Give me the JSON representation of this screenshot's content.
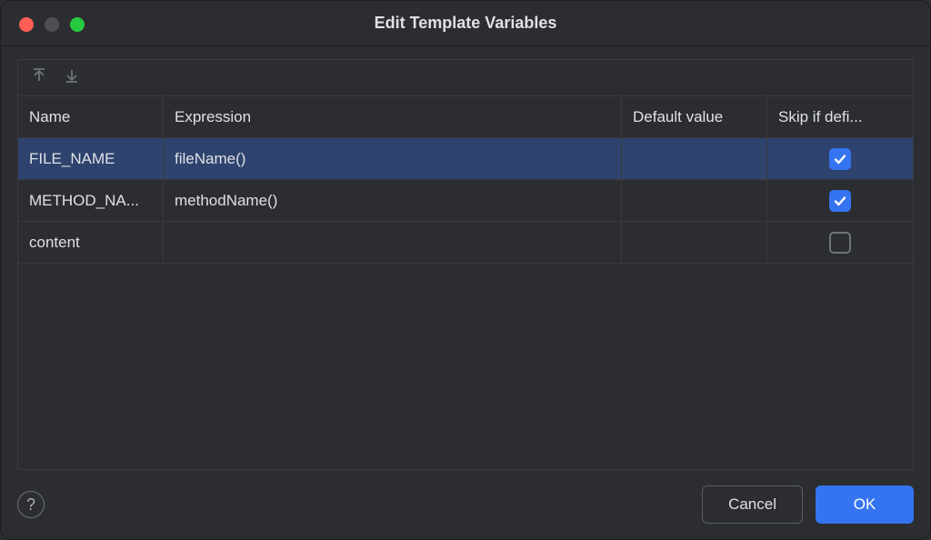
{
  "window": {
    "title": "Edit Template Variables"
  },
  "table": {
    "headers": {
      "name": "Name",
      "expression": "Expression",
      "default_value": "Default value",
      "skip": "Skip if defi..."
    },
    "rows": [
      {
        "name": "FILE_NAME",
        "expression": "fileName()",
        "default_value": "",
        "skip": true,
        "selected": true
      },
      {
        "name": "METHOD_NA...",
        "expression": "methodName()",
        "default_value": "",
        "skip": true,
        "selected": false
      },
      {
        "name": "content",
        "expression": "",
        "default_value": "",
        "skip": false,
        "selected": false
      }
    ]
  },
  "footer": {
    "cancel": "Cancel",
    "ok": "OK"
  }
}
